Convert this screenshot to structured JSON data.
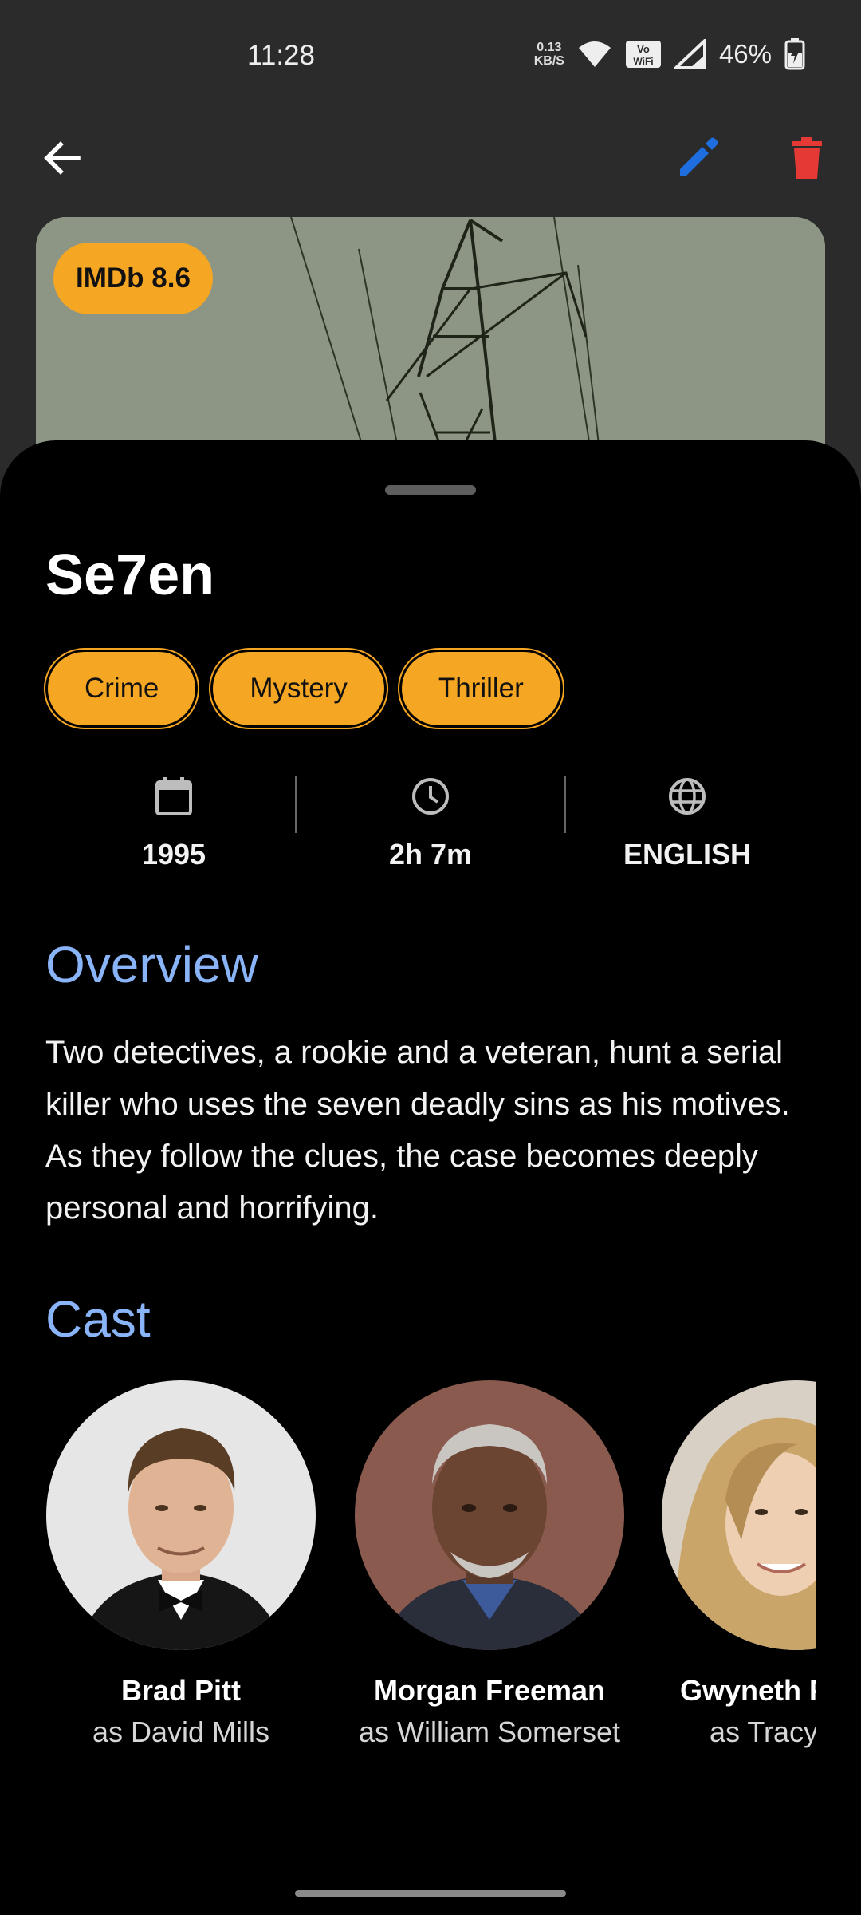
{
  "status_bar": {
    "time": "11:28",
    "net_speed_value": "0.13",
    "net_speed_unit": "KB/S",
    "battery_pct": "46%"
  },
  "icons": {
    "back": "arrow-left-icon",
    "edit": "pencil-icon",
    "delete": "trash-icon",
    "year": "calendar-icon",
    "runtime": "clock-icon",
    "language": "globe-icon"
  },
  "colors": {
    "accent_amber": "#f5a623",
    "section_blue": "#8ab4f8",
    "edit_blue": "#1e6ee0",
    "delete_red": "#e53935"
  },
  "movie": {
    "rating_badge": "IMDb 8.6",
    "title": "Se7en",
    "genres": [
      "Crime",
      "Mystery",
      "Thriller"
    ],
    "year": "1995",
    "runtime": "2h 7m",
    "language": "ENGLISH"
  },
  "overview": {
    "heading": "Overview",
    "text": "Two detectives, a rookie and a veteran, hunt a serial killer who uses the seven deadly sins as his motives. As they follow the clues, the case becomes deeply personal and horrifying."
  },
  "cast": {
    "heading": "Cast",
    "members": [
      {
        "name": "Brad Pitt",
        "role": "as David Mills"
      },
      {
        "name": "Morgan Freeman",
        "role": "as William Somerset"
      },
      {
        "name": "Gwyneth Paltrow",
        "role": "as Tracy Mills"
      }
    ]
  }
}
